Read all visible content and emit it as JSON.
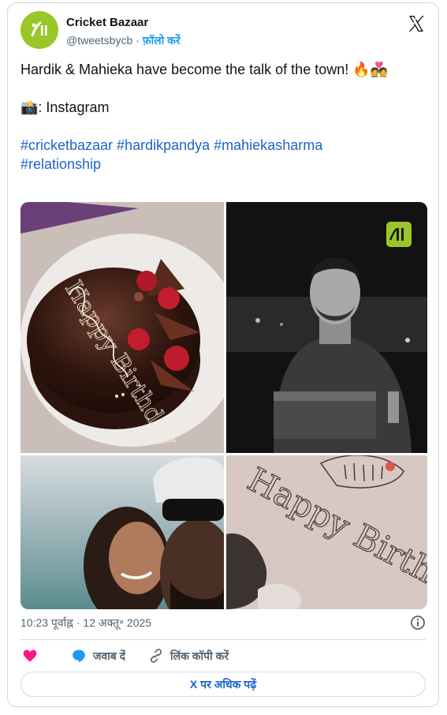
{
  "account": {
    "name": "Cricket Bazaar",
    "handle": "@tweetsbycb",
    "separator": "·",
    "follow_label": "फ़ॉलो करें"
  },
  "tweet": {
    "line1": "Hardik & Mahieka have become the talk of the town! 🔥💑",
    "line2": "📸: Instagram",
    "hashtags_line1": "#cricketbazaar #hardikpandya #mahiekasharma",
    "hashtags_line2": "#relationship"
  },
  "photos": {
    "cake_text": "Happy Birthday",
    "plate_text": "Happy Birthday"
  },
  "meta": {
    "timestamp": "10:23 पूर्वाह्न · 12 अक्तू॰ 2025"
  },
  "actions": {
    "reply_label": "जवाब दें",
    "copy_link_label": "लिंक कॉपी करें"
  },
  "read_more_label": "X पर अधिक पढ़ें",
  "colors": {
    "brand_green": "#99c628",
    "link_blue": "#1d64c8",
    "like_pink": "#f91880",
    "reply_blue": "#1d9bf0"
  }
}
